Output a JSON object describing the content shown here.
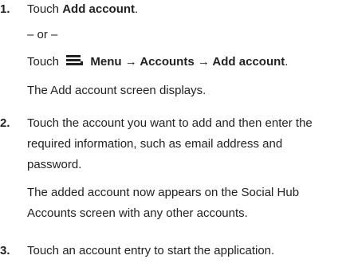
{
  "steps": [
    {
      "number": "1.",
      "line1_pre": "Touch ",
      "line1_bold": "Add account",
      "line1_post": ".",
      "or": "– or –",
      "line2_pre": "Touch",
      "line2_bold": "Menu → Accounts → Add account",
      "line2_post": ".",
      "result": "The Add account screen displays."
    },
    {
      "number": "2.",
      "text_lines": [
        "Touch the account you want to add and then enter the",
        "required information, such as email address and",
        "password."
      ],
      "result_lines": [
        "The added account now appears on the Social Hub",
        "Accounts screen with any other accounts."
      ]
    },
    {
      "number": "3.",
      "text": "Touch an account entry to start the application."
    }
  ],
  "icons": {
    "menu": "menu-key-icon"
  }
}
